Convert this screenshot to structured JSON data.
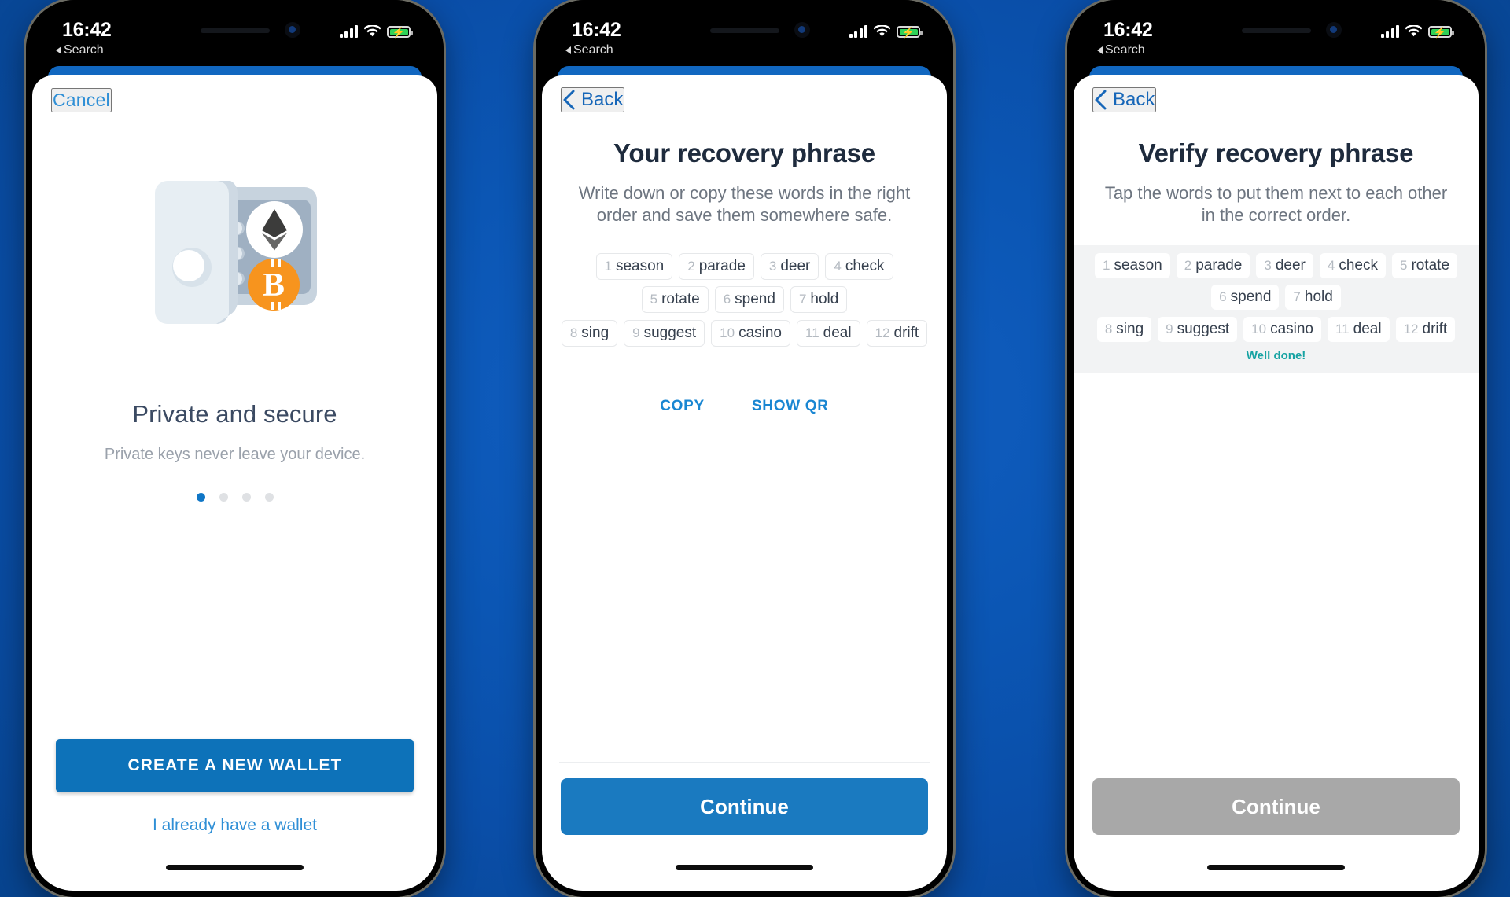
{
  "theme": {
    "background_blue": "#0b56b4",
    "accent_blue": "#0d72b9",
    "link_blue": "#2f8fd6",
    "success_teal": "#17a3a3",
    "disabled_gray": "#a8a8a8",
    "heading_navy": "#1e2b3d"
  },
  "status_bar": {
    "time": "16:42",
    "back_label": "Search",
    "icons": [
      "cellular-signal-icon",
      "wifi-icon",
      "battery-charging-icon"
    ]
  },
  "screens": [
    {
      "id": "onboarding",
      "nav": {
        "label": "Cancel",
        "type": "cancel"
      },
      "illustration": "safe-with-crypto-coins-illustration",
      "title": "Private and secure",
      "subtitle": "Private keys never leave your device.",
      "pagination": {
        "total": 4,
        "active_index": 0
      },
      "primary_button": "CREATE A NEW WALLET",
      "secondary_link": "I already have a wallet"
    },
    {
      "id": "recovery-phrase",
      "nav": {
        "label": "Back",
        "type": "back"
      },
      "title": "Your recovery phrase",
      "subtitle": "Write down or copy these words in the right order and save them somewhere safe.",
      "words_row1": [
        {
          "num": "1",
          "word": "season"
        },
        {
          "num": "2",
          "word": "parade"
        },
        {
          "num": "3",
          "word": "deer"
        },
        {
          "num": "4",
          "word": "check"
        },
        {
          "num": "5",
          "word": "rotate"
        },
        {
          "num": "6",
          "word": "spend"
        },
        {
          "num": "7",
          "word": "hold"
        }
      ],
      "words_row2": [
        {
          "num": "8",
          "word": "sing"
        },
        {
          "num": "9",
          "word": "suggest"
        },
        {
          "num": "10",
          "word": "casino"
        },
        {
          "num": "11",
          "word": "deal"
        },
        {
          "num": "12",
          "word": "drift"
        }
      ],
      "actions": [
        "COPY",
        "SHOW QR"
      ],
      "cta": {
        "label": "Continue",
        "state": "enabled"
      }
    },
    {
      "id": "verify-recovery-phrase",
      "nav": {
        "label": "Back",
        "type": "back"
      },
      "title": "Verify recovery phrase",
      "subtitle": "Tap the words to put them next to each other in the correct order.",
      "words_row1": [
        {
          "num": "1",
          "word": "season"
        },
        {
          "num": "2",
          "word": "parade"
        },
        {
          "num": "3",
          "word": "deer"
        },
        {
          "num": "4",
          "word": "check"
        },
        {
          "num": "5",
          "word": "rotate"
        },
        {
          "num": "6",
          "word": "spend"
        },
        {
          "num": "7",
          "word": "hold"
        }
      ],
      "words_row2": [
        {
          "num": "8",
          "word": "sing"
        },
        {
          "num": "9",
          "word": "suggest"
        },
        {
          "num": "10",
          "word": "casino"
        },
        {
          "num": "11",
          "word": "deal"
        },
        {
          "num": "12",
          "word": "drift"
        }
      ],
      "feedback": "Well done!",
      "cta": {
        "label": "Continue",
        "state": "disabled"
      }
    }
  ]
}
